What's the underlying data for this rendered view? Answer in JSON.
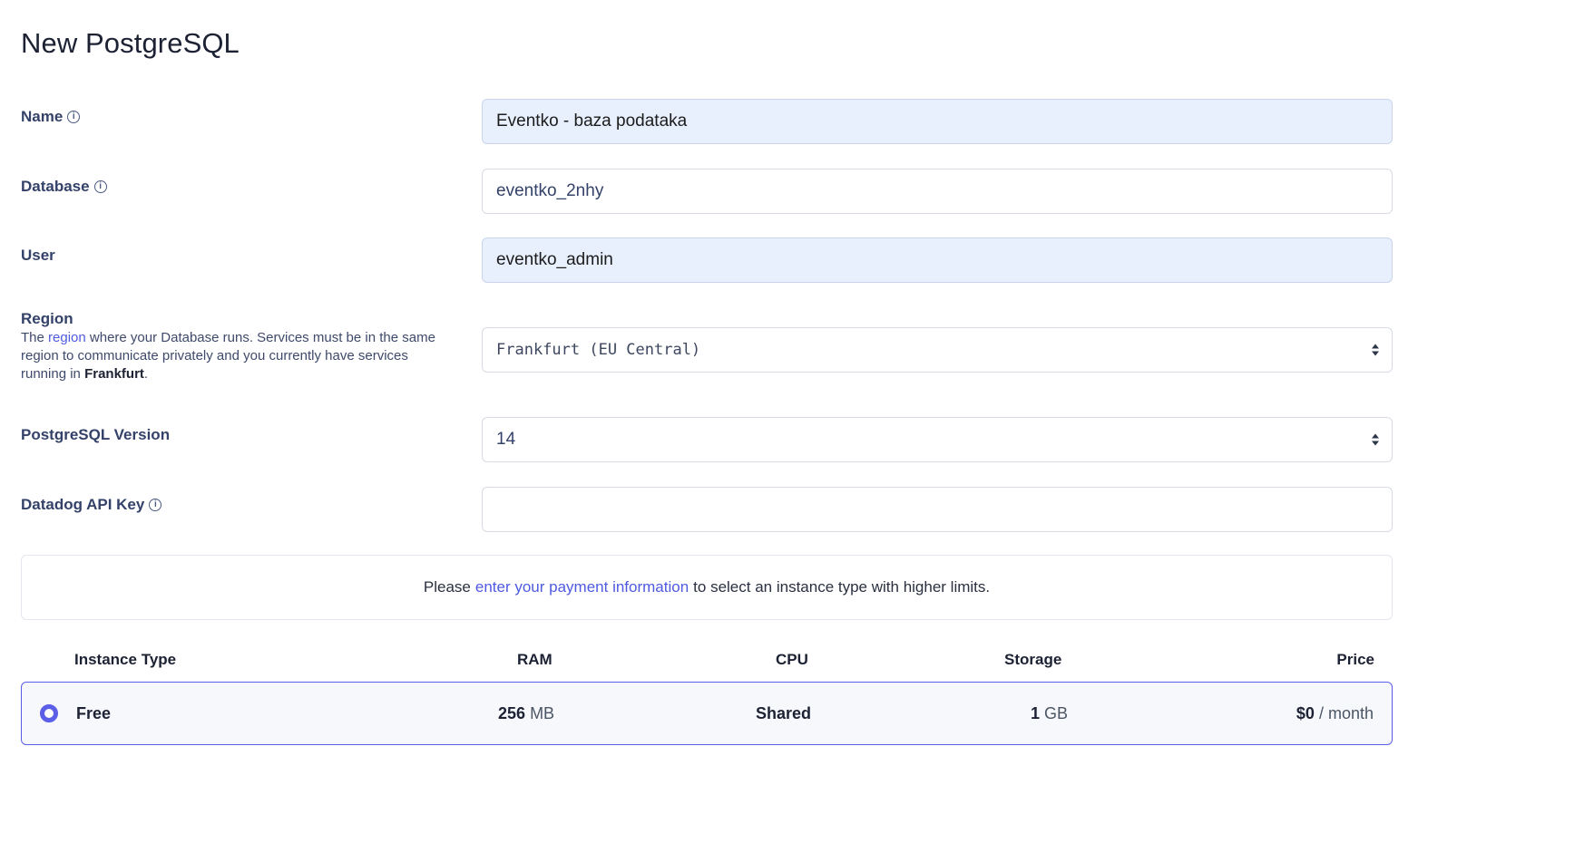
{
  "page": {
    "title": "New PostgreSQL"
  },
  "form": {
    "name": {
      "label": "Name",
      "value": "Eventko - baza podataka"
    },
    "database": {
      "label": "Database",
      "value": "eventko_2nhy"
    },
    "user": {
      "label": "User",
      "value": "eventko_admin"
    },
    "region": {
      "label": "Region",
      "help_prefix": "The",
      "help_link": "region",
      "help_middle": "where your Database runs. Services must be in the same region to communicate privately and you currently have services running in",
      "help_bold": "Frankfurt",
      "help_suffix": ".",
      "selected": "Frankfurt (EU Central)"
    },
    "version": {
      "label": "PostgreSQL Version",
      "selected": "14"
    },
    "datadog": {
      "label": "Datadog API Key",
      "value": ""
    }
  },
  "notice": {
    "prefix": "Please",
    "link": "enter your payment information",
    "suffix": "to select an instance type with higher limits."
  },
  "instance_table": {
    "headers": {
      "type": "Instance Type",
      "ram": "RAM",
      "cpu": "CPU",
      "storage": "Storage",
      "price": "Price"
    },
    "rows": [
      {
        "type": "Free",
        "ram_value": "256",
        "ram_unit": "MB",
        "cpu": "Shared",
        "storage_value": "1",
        "storage_unit": "GB",
        "price_value": "$0",
        "price_unit": "/ month",
        "selected": true
      }
    ]
  },
  "colors": {
    "accent": "#5b5ee6",
    "link": "#4f5ae0",
    "label": "#34426a",
    "autofill_bg": "#e8f0fe"
  }
}
